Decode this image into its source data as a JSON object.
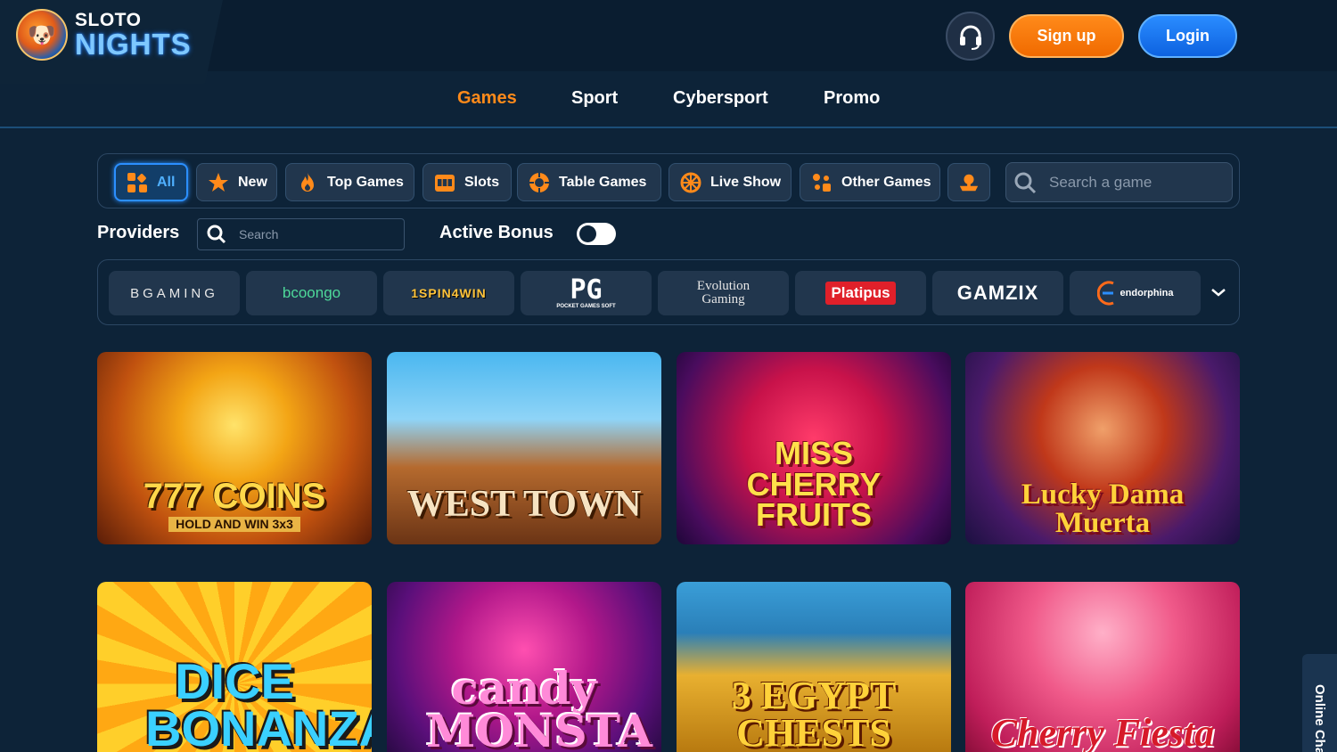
{
  "brand": {
    "line1": "SLOTO",
    "line2": "NIGHTS"
  },
  "header": {
    "signup_label": "Sign up",
    "login_label": "Login"
  },
  "nav": [
    {
      "label": "Games",
      "active": true
    },
    {
      "label": "Sport",
      "active": false
    },
    {
      "label": "Cybersport",
      "active": false
    },
    {
      "label": "Promo",
      "active": false
    }
  ],
  "categories": [
    {
      "label": "All",
      "icon": "grid-icon",
      "active": true
    },
    {
      "label": "New",
      "icon": "star-icon"
    },
    {
      "label": "Top Games",
      "icon": "fire-icon"
    },
    {
      "label": "Slots",
      "icon": "slot-machine-icon"
    },
    {
      "label": "Table Games",
      "icon": "poker-chip-icon"
    },
    {
      "label": "Live Show",
      "icon": "wheel-icon"
    },
    {
      "label": "Other Games",
      "icon": "puzzle-icon"
    },
    {
      "label": "",
      "icon": "lottery-icon"
    }
  ],
  "search": {
    "placeholder": "Search a game"
  },
  "providers": {
    "title": "Providers",
    "search_placeholder": "Search",
    "active_bonus_label": "Active Bonus",
    "active_bonus_on": false,
    "items": [
      {
        "label": "BGAMING"
      },
      {
        "label": "bcoongo"
      },
      {
        "label": "1SPIN4WIN"
      },
      {
        "label": "PG",
        "sub": "POCKET GAMES SOFT"
      },
      {
        "label": "Evolution",
        "sub": "Gaming"
      },
      {
        "label": "Platipus"
      },
      {
        "label": "GAMZIX"
      },
      {
        "label": "endorphina"
      }
    ]
  },
  "games": [
    {
      "title": "777 COINS",
      "subtitle": "HOLD AND WIN 3x3"
    },
    {
      "title": "WEST TOWN",
      "subtitle": ""
    },
    {
      "title": "MISS CHERRY FRUITS",
      "subtitle": ""
    },
    {
      "title": "Lucky Dama Muerta",
      "subtitle": ""
    },
    {
      "title": "DICE BONANZA",
      "subtitle": ""
    },
    {
      "title": "candy MONSTA",
      "subtitle": ""
    },
    {
      "title": "3 EGYPT CHESTS",
      "subtitle": ""
    },
    {
      "title": "Cherry Fiesta",
      "subtitle": ""
    }
  ],
  "online_chat": {
    "label": "Online Chat"
  },
  "colors": {
    "accent": "#ff8a1a",
    "primary": "#2b8fff",
    "background": "#0d2338"
  }
}
